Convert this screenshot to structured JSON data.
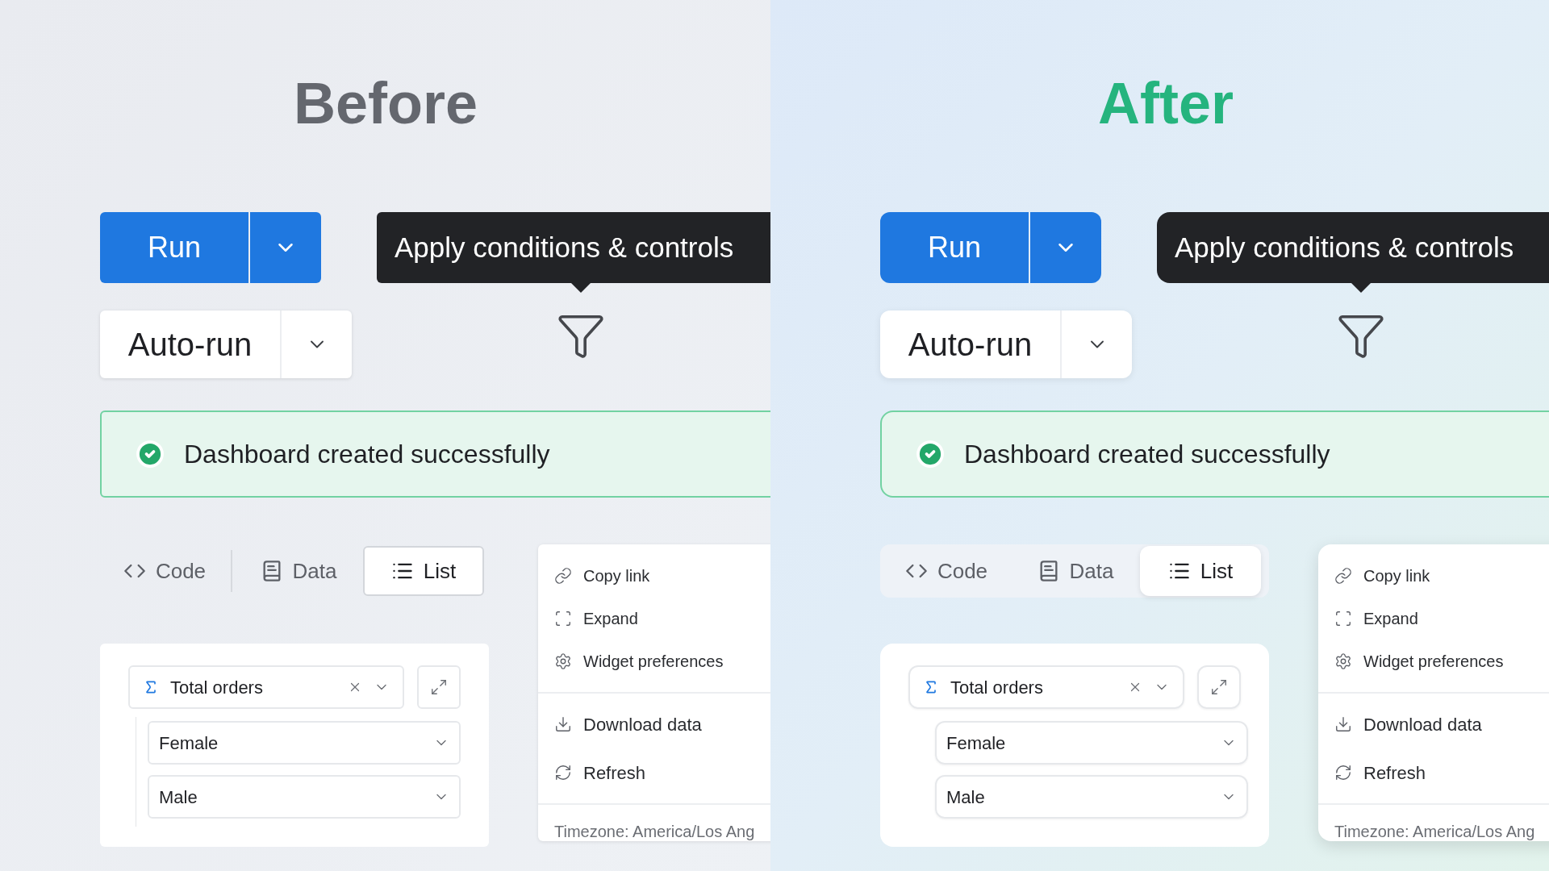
{
  "panels": [
    {
      "kind": "before",
      "title": "Before",
      "run_button": {
        "label": "Run"
      },
      "auto_run": {
        "label": "Auto-run"
      },
      "tooltip": {
        "text": "Apply conditions & controls"
      },
      "banner": {
        "text": "Dashboard created successfully"
      },
      "tabs": [
        {
          "label": "Code",
          "selected": false
        },
        {
          "label": "Data",
          "selected": false
        },
        {
          "label": "List",
          "selected": true
        }
      ],
      "widget": {
        "measure": "Total orders",
        "groups": [
          "Female",
          "Male"
        ]
      },
      "menu": {
        "sections": [
          [
            "Copy link",
            "Expand",
            "Widget preferences"
          ],
          [
            "Download data",
            "Refresh"
          ]
        ],
        "footer": "Timezone: America/Los Ang"
      }
    },
    {
      "kind": "after",
      "title": "After",
      "run_button": {
        "label": "Run"
      },
      "auto_run": {
        "label": "Auto-run"
      },
      "tooltip": {
        "text": "Apply conditions & controls"
      },
      "banner": {
        "text": "Dashboard created successfully"
      },
      "tabs": [
        {
          "label": "Code",
          "selected": false
        },
        {
          "label": "Data",
          "selected": false
        },
        {
          "label": "List",
          "selected": true
        }
      ],
      "widget": {
        "measure": "Total orders",
        "groups": [
          "Female",
          "Male"
        ]
      },
      "menu": {
        "sections": [
          [
            "Copy link",
            "Expand",
            "Widget preferences"
          ],
          [
            "Download data",
            "Refresh"
          ]
        ],
        "footer": "Timezone: America/Los Ang"
      }
    }
  ]
}
